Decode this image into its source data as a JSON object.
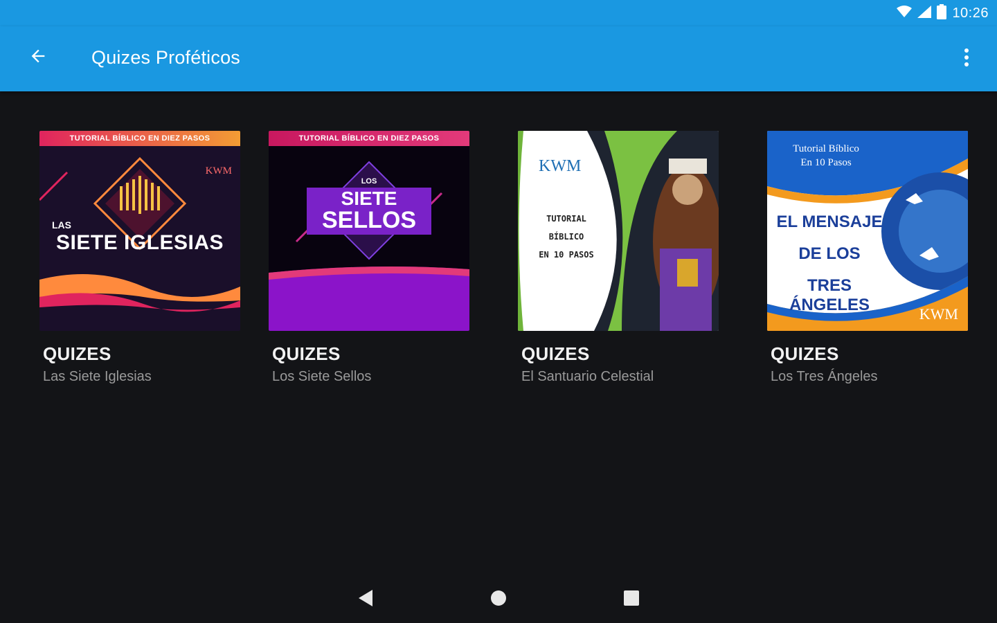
{
  "status": {
    "time": "10:26"
  },
  "appbar": {
    "title": "Quizes Proféticos"
  },
  "cards": [
    {
      "title": "QUIZES",
      "subtitle": "Las Siete Iglesias",
      "art": {
        "banner": "TUTORIAL BÍBLICO EN DIEZ PASOS",
        "small": "LAS",
        "big": "SIETE IGLESIAS",
        "logo": "KWM"
      }
    },
    {
      "title": "QUIZES",
      "subtitle": "Los Siete Sellos",
      "art": {
        "banner": "TUTORIAL BÍBLICO EN DIEZ PASOS",
        "small": "LOS",
        "line1": "SIETE",
        "line2": "SELLOS"
      }
    },
    {
      "title": "QUIZES",
      "subtitle": "El Santuario Celestial",
      "art": {
        "logo": "KWM",
        "line1": "TUTORIAL",
        "line2": "BÍBLICO",
        "line3": "EN 10 PASOS"
      }
    },
    {
      "title": "QUIZES",
      "subtitle": "Los Tres Ángeles",
      "art": {
        "head1": "Tutorial Bíblico",
        "head2": "En 10 Pasos",
        "line1": "EL MENSAJE",
        "line2": "DE LOS",
        "line3": "TRES ÁNGELES",
        "logo": "KWM"
      }
    }
  ],
  "colors": {
    "appbar": "#1a98e1",
    "background": "#131417"
  },
  "icons": [
    "wifi-icon",
    "signal-icon",
    "battery-icon",
    "back-arrow-icon",
    "more-vert-icon",
    "nav-back-icon",
    "nav-home-icon",
    "nav-recents-icon"
  ]
}
